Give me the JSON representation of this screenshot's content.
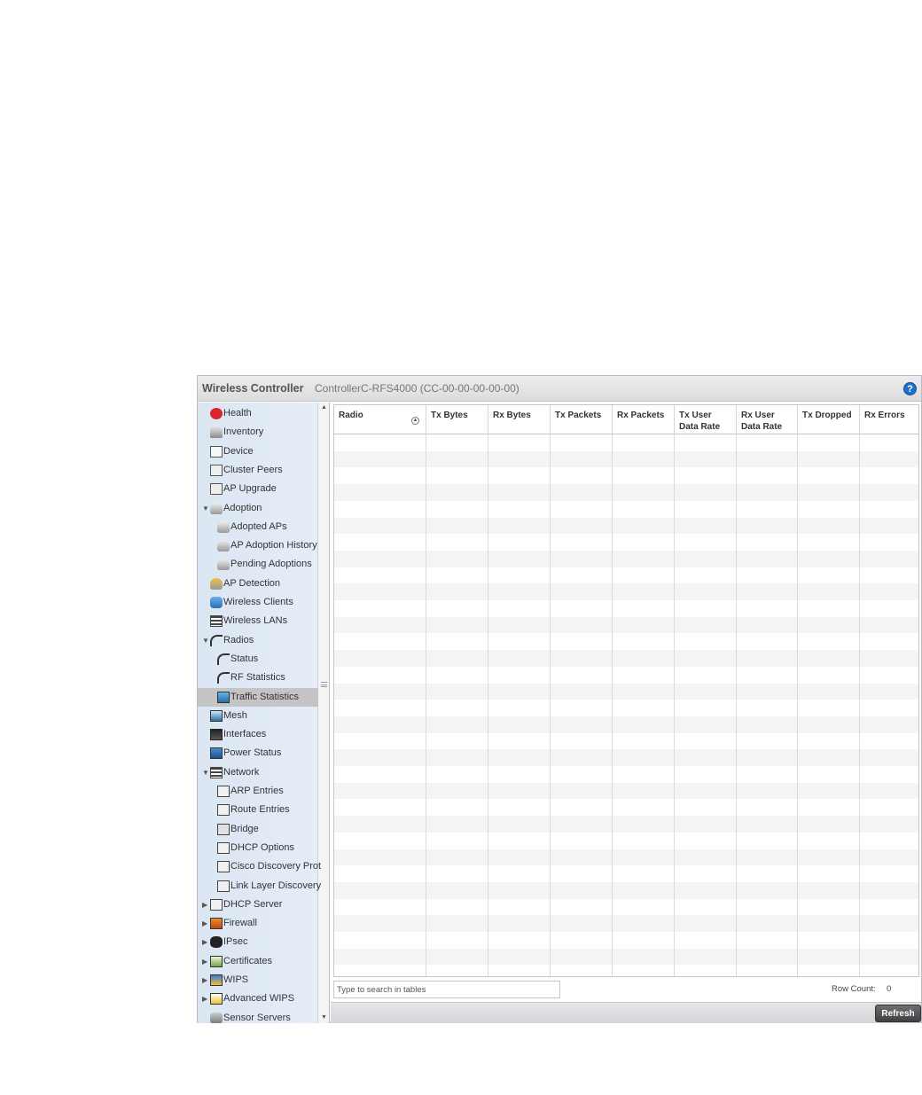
{
  "header": {
    "title": "Wireless Controller",
    "device": "ControllerC-RFS4000 (CC-00-00-00-00-00)",
    "help": "?"
  },
  "sidebar": {
    "items": [
      {
        "label": "Health",
        "icon": "health-icon",
        "arrow": ""
      },
      {
        "label": "Inventory",
        "icon": "inventory-icon",
        "arrow": ""
      },
      {
        "label": "Device",
        "icon": "device-icon",
        "arrow": ""
      },
      {
        "label": "Cluster Peers",
        "icon": "cluster-peers-icon",
        "arrow": ""
      },
      {
        "label": "AP Upgrade",
        "icon": "ap-upgrade-icon",
        "arrow": ""
      },
      {
        "label": "Adoption",
        "icon": "adoption-icon",
        "arrow": "▼"
      },
      {
        "label": "Adopted APs",
        "icon": "adopted-aps-icon",
        "arrow": ""
      },
      {
        "label": "AP Adoption History",
        "icon": "adoption-history-icon",
        "arrow": ""
      },
      {
        "label": "Pending Adoptions",
        "icon": "pending-adoptions-icon",
        "arrow": ""
      },
      {
        "label": "AP Detection",
        "icon": "ap-detection-icon",
        "arrow": ""
      },
      {
        "label": "Wireless Clients",
        "icon": "wireless-clients-icon",
        "arrow": ""
      },
      {
        "label": "Wireless LANs",
        "icon": "wireless-lans-icon",
        "arrow": ""
      },
      {
        "label": "Radios",
        "icon": "radios-icon",
        "arrow": "▼"
      },
      {
        "label": "Status",
        "icon": "radio-status-icon",
        "arrow": ""
      },
      {
        "label": "RF Statistics",
        "icon": "rf-statistics-icon",
        "arrow": ""
      },
      {
        "label": "Traffic Statistics",
        "icon": "traffic-statistics-icon",
        "arrow": ""
      },
      {
        "label": "Mesh",
        "icon": "mesh-icon",
        "arrow": ""
      },
      {
        "label": "Interfaces",
        "icon": "interfaces-icon",
        "arrow": ""
      },
      {
        "label": "Power Status",
        "icon": "power-status-icon",
        "arrow": ""
      },
      {
        "label": "Network",
        "icon": "network-icon",
        "arrow": "▼"
      },
      {
        "label": "ARP Entries",
        "icon": "arp-entries-icon",
        "arrow": ""
      },
      {
        "label": "Route Entries",
        "icon": "route-entries-icon",
        "arrow": ""
      },
      {
        "label": "Bridge",
        "icon": "bridge-icon",
        "arrow": ""
      },
      {
        "label": "DHCP Options",
        "icon": "dhcp-options-icon",
        "arrow": ""
      },
      {
        "label": "Cisco Discovery Prot",
        "icon": "cisco-discovery-icon",
        "arrow": ""
      },
      {
        "label": "Link Layer Discovery",
        "icon": "link-layer-discovery-icon",
        "arrow": ""
      },
      {
        "label": "DHCP Server",
        "icon": "dhcp-server-icon",
        "arrow": "▶"
      },
      {
        "label": "Firewall",
        "icon": "firewall-icon",
        "arrow": "▶"
      },
      {
        "label": "IPsec",
        "icon": "ipsec-icon",
        "arrow": "▶"
      },
      {
        "label": "Certificates",
        "icon": "certificates-icon",
        "arrow": "▶"
      },
      {
        "label": "WIPS",
        "icon": "wips-icon",
        "arrow": "▶"
      },
      {
        "label": "Advanced WIPS",
        "icon": "advanced-wips-icon",
        "arrow": "▶"
      },
      {
        "label": "Sensor Servers",
        "icon": "sensor-servers-icon",
        "arrow": ""
      }
    ],
    "selected": "Traffic Statistics"
  },
  "table": {
    "columns": [
      {
        "label": "Radio"
      },
      {
        "label": "Tx Bytes"
      },
      {
        "label": "Rx Bytes"
      },
      {
        "label": "Tx Packets"
      },
      {
        "label": "Rx Packets"
      },
      {
        "label": "Tx User Data Rate"
      },
      {
        "label": "Rx User Data Rate"
      },
      {
        "label": "Tx Dropped"
      },
      {
        "label": "Rx Errors"
      }
    ],
    "rows": []
  },
  "search": {
    "placeholder": "Type to search in tables"
  },
  "row_count": {
    "label": "Row Count:",
    "value": "0"
  },
  "refresh_label": "Refresh"
}
